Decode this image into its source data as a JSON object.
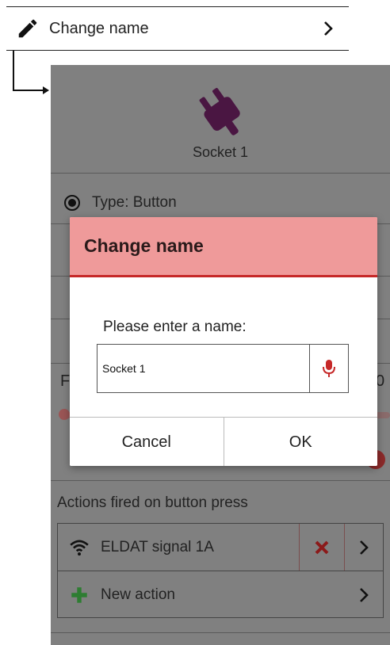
{
  "top_item": {
    "label": "Change name"
  },
  "screen": {
    "device_name": "Socket 1",
    "type_row": "Type: Button",
    "partial_left": "F",
    "partial_right": "0",
    "section_label": "Actions fired on button press",
    "actions": [
      {
        "label": "ELDAT signal 1A"
      },
      {
        "label": "New action"
      }
    ]
  },
  "dialog": {
    "title": "Change name",
    "prompt": "Please enter a name:",
    "input_value": "Socket 1",
    "cancel_label": "Cancel",
    "ok_label": "OK"
  },
  "colors": {
    "plug": "#4a1642",
    "dialog_header": "#ef9a9a",
    "dialog_header_border": "#c62828",
    "mic": "#c62828",
    "add_action": "#2e7d32",
    "delete_action": "#8b1a1a"
  }
}
